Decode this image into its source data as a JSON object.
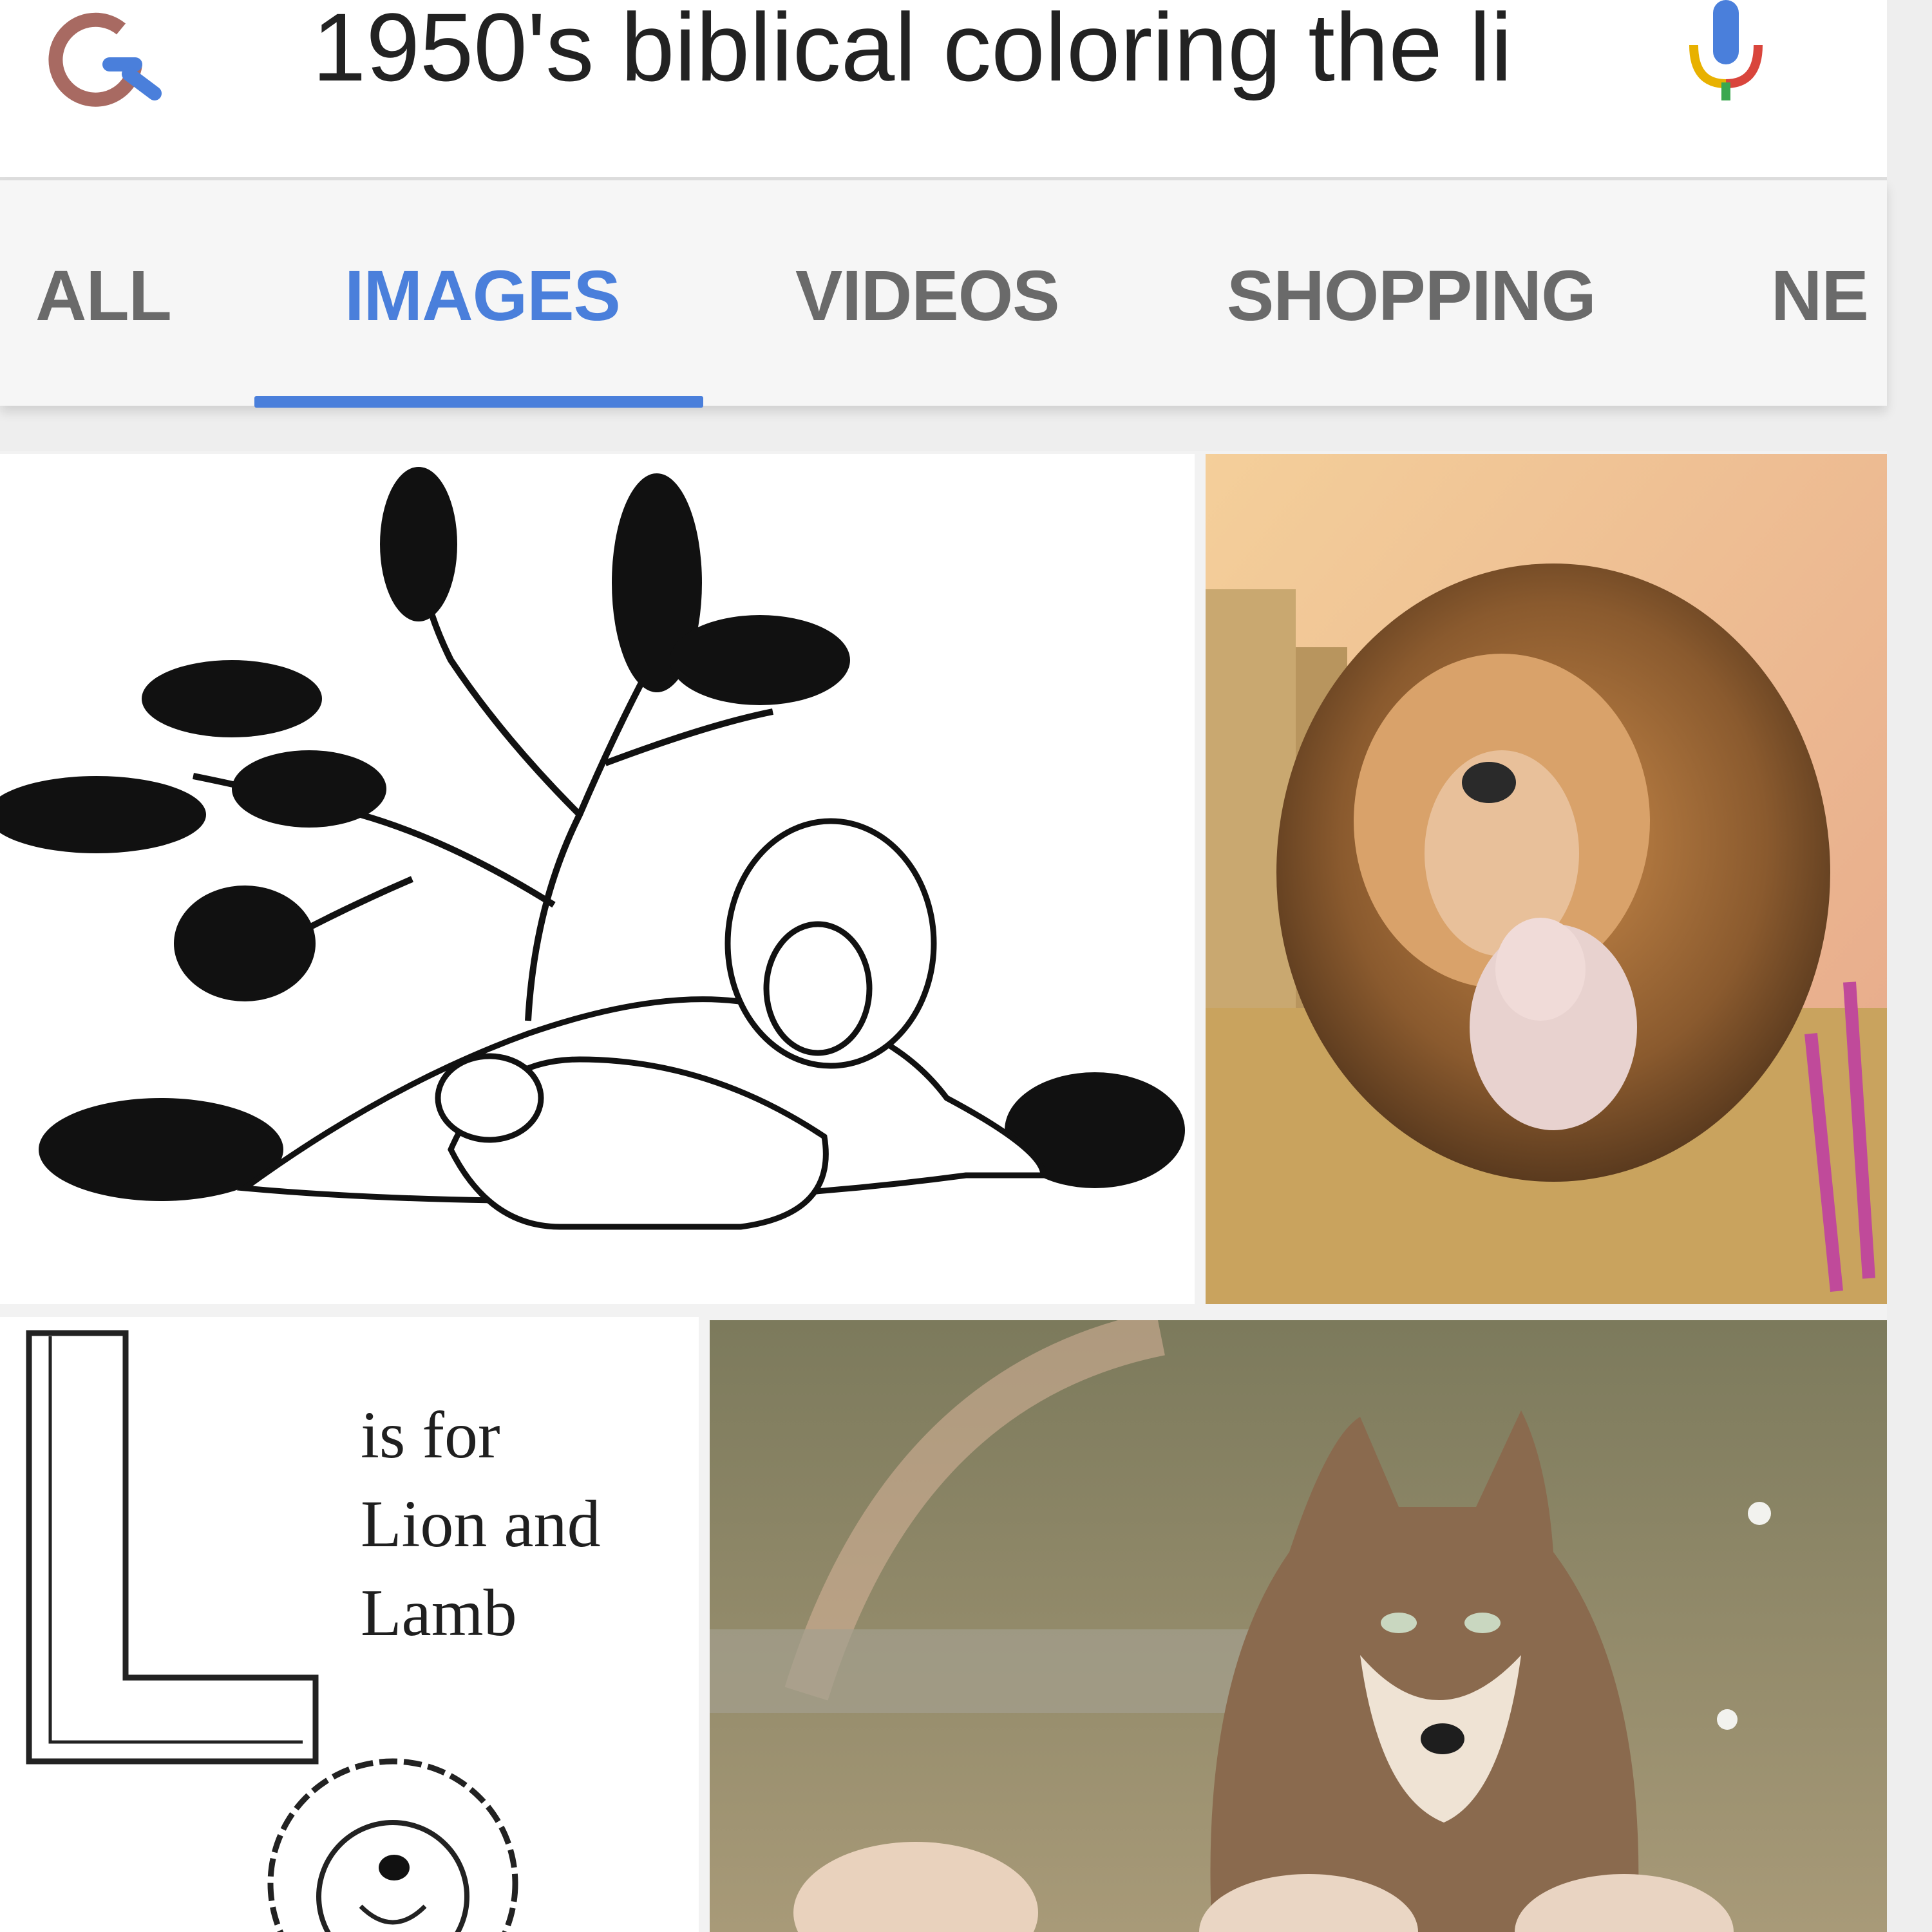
{
  "search": {
    "query": "1950's biblical coloring the li"
  },
  "icons": {
    "logo": "google-g-icon",
    "mic": "microphone-icon"
  },
  "tabs": [
    {
      "label": "ALL",
      "active": false
    },
    {
      "label": "IMAGES",
      "active": true
    },
    {
      "label": "VIDEOS",
      "active": false
    },
    {
      "label": "SHOPPING",
      "active": false
    },
    {
      "label": "NE",
      "active": false
    }
  ],
  "results": {
    "letter_card": {
      "letter": "L",
      "line1": "is for",
      "line2": "Lion and",
      "line3": "Lamb"
    }
  },
  "colors": {
    "accent": "#4a7fdb",
    "tab_text": "#6a6a6a"
  }
}
